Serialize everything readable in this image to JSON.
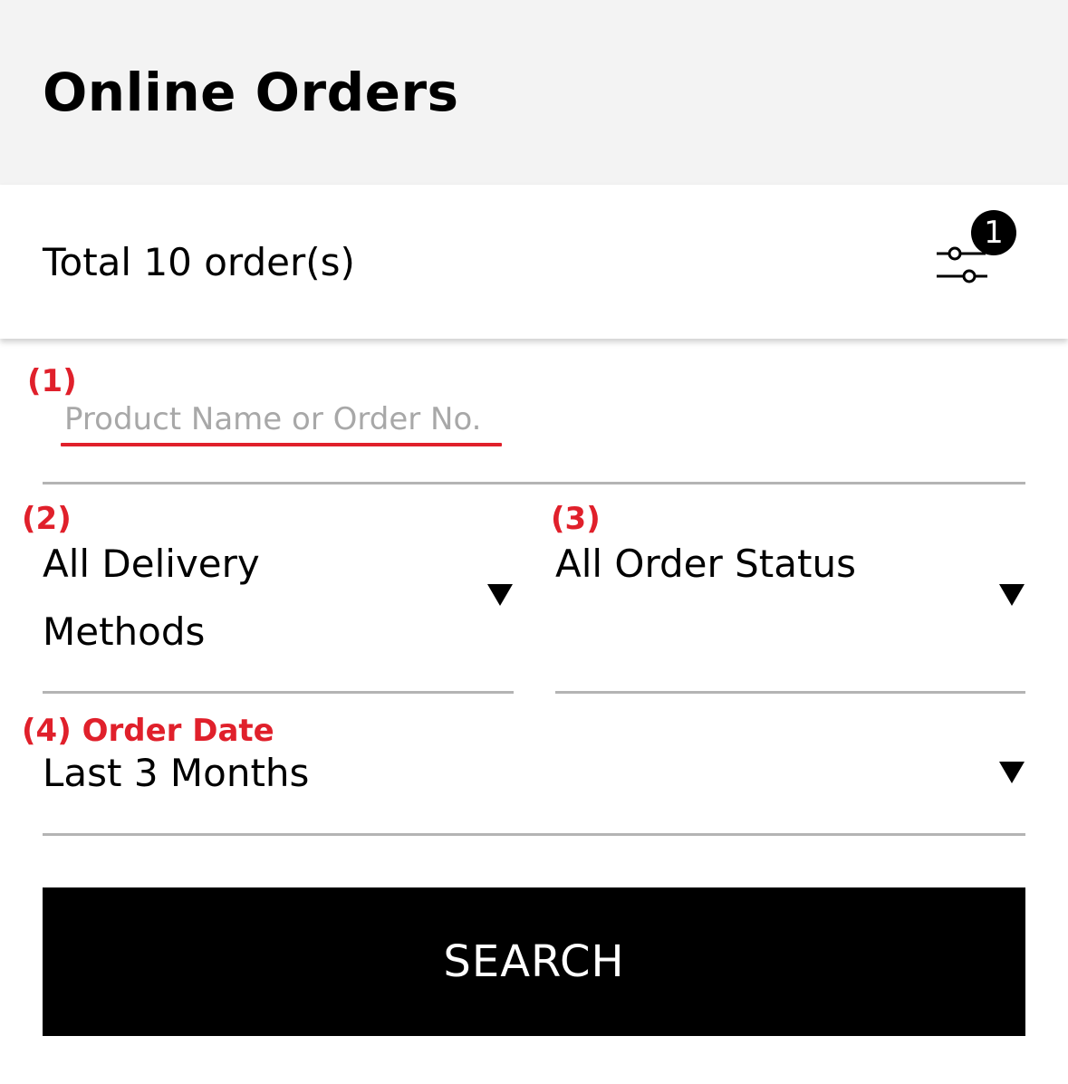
{
  "header": {
    "title": "Online Orders"
  },
  "summary": {
    "total_text": "Total 10 order(s)",
    "filter_icon": "filter-sliders-icon",
    "filter_badge_count": "1"
  },
  "annotations": {
    "search_marker": "(1)",
    "delivery_marker": "(2)",
    "status_marker": "(3)",
    "date_marker": "(4)",
    "date_label": "Order Date",
    "color": "#e0202b"
  },
  "search": {
    "placeholder": "Product Name or Order No.",
    "value": ""
  },
  "delivery_method": {
    "selected_line1": "All Delivery",
    "selected_line2": "Methods"
  },
  "order_status": {
    "selected": "All Order Status"
  },
  "order_date": {
    "selected": "Last 3 Months"
  },
  "actions": {
    "search_label": "SEARCH"
  }
}
